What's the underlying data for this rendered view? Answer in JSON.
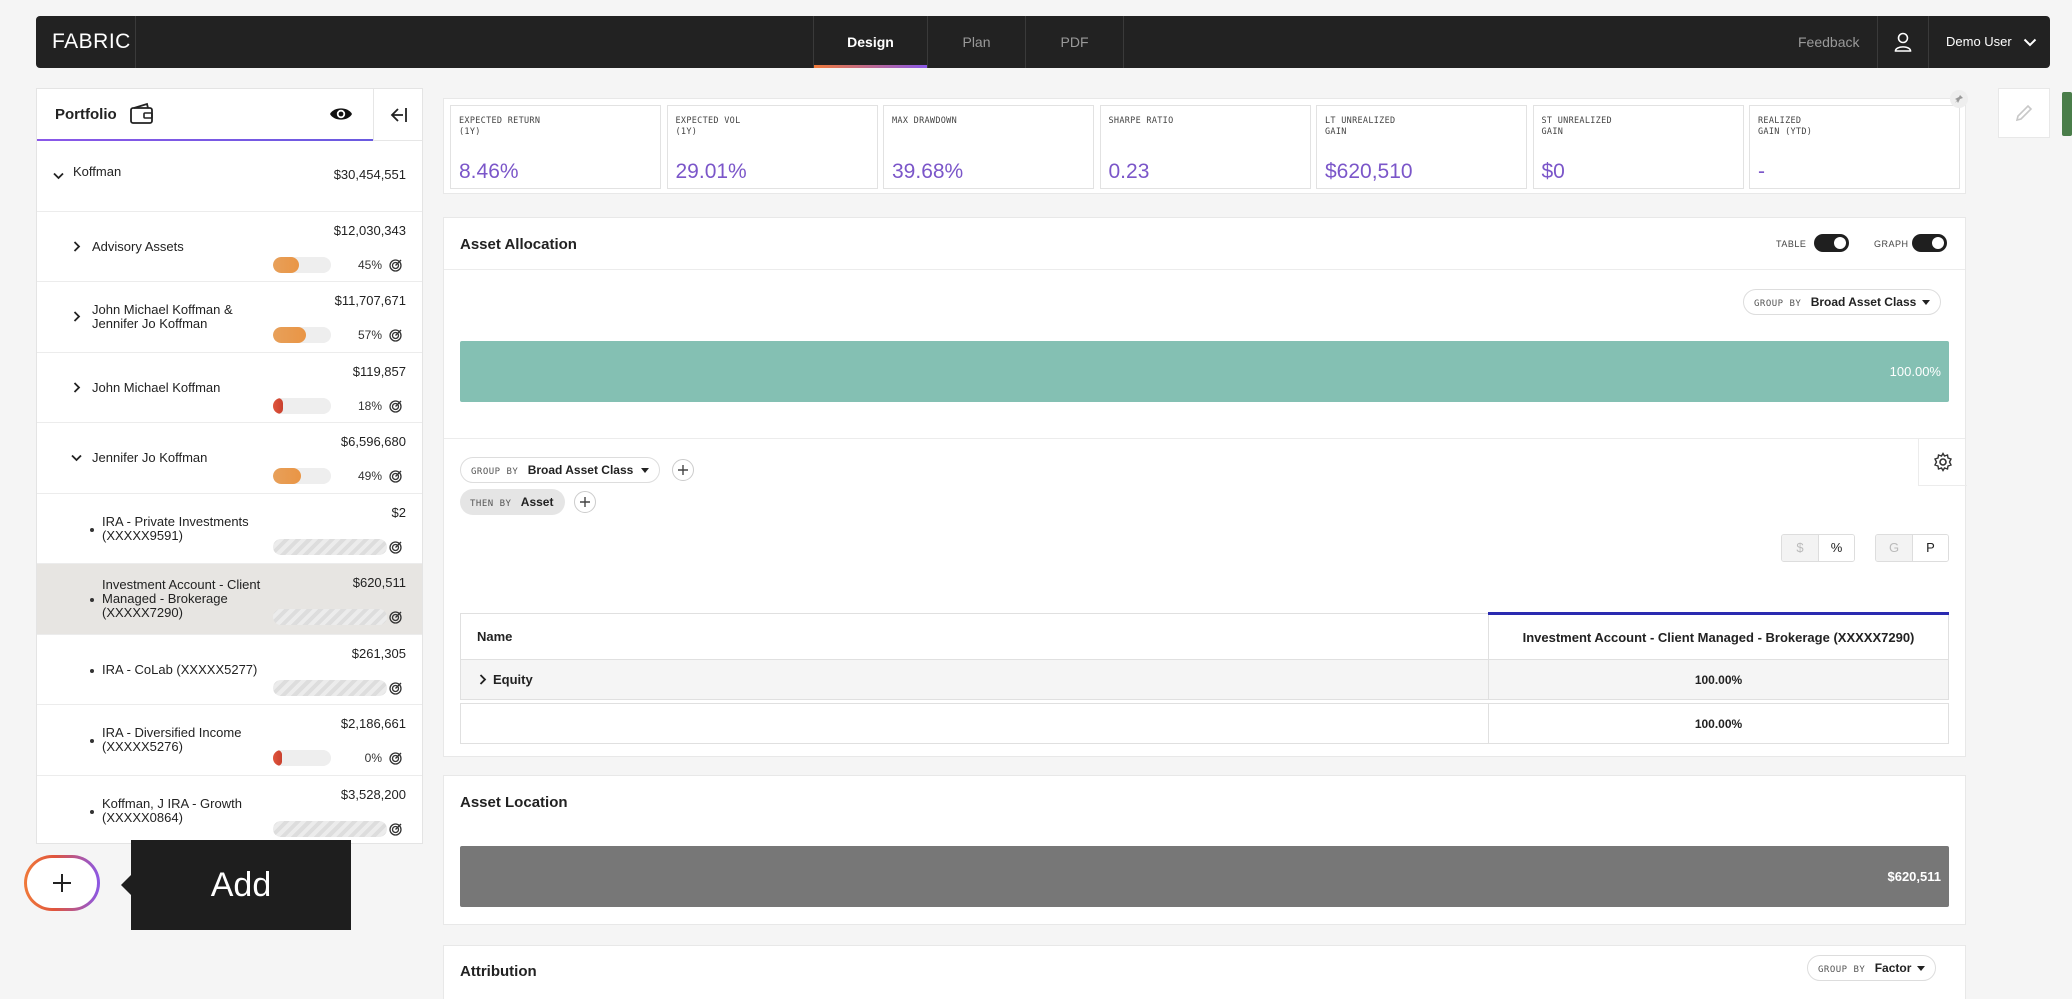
{
  "nav": {
    "logo": "FABRIC",
    "tabs": [
      {
        "label": "Design",
        "active": true
      },
      {
        "label": "Plan",
        "active": false
      },
      {
        "label": "PDF",
        "active": false
      }
    ],
    "feedback": "Feedback",
    "user_name": "Demo User",
    "icons": {
      "user": "user-icon",
      "chevron": "chevron-down-icon"
    }
  },
  "portfolio": {
    "title": "Portfolio",
    "icons": {
      "wallet": "wallet-icon",
      "eye": "eye-icon",
      "collapse": "collapse-left-icon"
    },
    "rows": [
      {
        "name": "Koffman",
        "amount": "$30,454,551"
      },
      {
        "name": "Advisory Assets",
        "amount": "$12,030,343",
        "pct": "45%",
        "fill": 0.45
      },
      {
        "name": "John Michael Koffman & Jennifer Jo Koffman",
        "amount": "$11,707,671",
        "pct": "57%",
        "fill": 0.57
      },
      {
        "name": "John Michael Koffman",
        "amount": "$119,857",
        "pct": "18%",
        "fill": 0.18
      },
      {
        "name": "Jennifer Jo Koffman",
        "amount": "$6,596,680",
        "pct": "49%",
        "fill": 0.49
      },
      {
        "name": "IRA - Private Investments (XXXXX9591)",
        "amount": "$2"
      },
      {
        "name": "Investment Account - Client Managed - Brokerage (XXXXX7290)",
        "amount": "$620,511"
      },
      {
        "name": "IRA - CoLab (XXXXX5277)",
        "amount": "$261,305"
      },
      {
        "name": "IRA - Diversified Income (XXXXX5276)",
        "amount": "$2,186,661",
        "pct": "0%",
        "fill": 0.0
      },
      {
        "name": "Koffman, J IRA - Growth (XXXXX0864)",
        "amount": "$3,528,200"
      }
    ]
  },
  "add_tooltip": "Add",
  "metrics": [
    {
      "label1": "EXPECTED RETURN",
      "label2": "(1Y)",
      "value": "8.46%"
    },
    {
      "label1": "EXPECTED VOL",
      "label2": "(1Y)",
      "value": "29.01%"
    },
    {
      "label1": "MAX DRAWDOWN",
      "label2": "",
      "value": "39.68%"
    },
    {
      "label1": "SHARPE RATIO",
      "label2": "",
      "value": "0.23"
    },
    {
      "label1": "LT UNREALIZED",
      "label2": "GAIN",
      "value": "$620,510"
    },
    {
      "label1": "ST UNREALIZED",
      "label2": "GAIN",
      "value": "$0"
    },
    {
      "label1": "REALIZED",
      "label2": "GAIN (YTD)",
      "value": "-"
    }
  ],
  "asset_allocation": {
    "title": "Asset Allocation",
    "table_label": "TABLE",
    "graph_label": "GRAPH",
    "group_by_label": "GROUP BY",
    "group_by_value": "Broad Asset Class",
    "bar_value": "100.00%",
    "then_by_label": "THEN BY",
    "then_by_value": "Asset",
    "seg1": [
      "$",
      "%"
    ],
    "seg2": [
      "G",
      "P"
    ],
    "table": {
      "col_name": "Name",
      "col_account": "Investment Account - Client Managed - Brokerage (XXXXX7290)",
      "rows": [
        {
          "name": "Equity",
          "value": "100.00%"
        },
        {
          "name": "",
          "value": "100.00%"
        }
      ]
    }
  },
  "asset_location": {
    "title": "Asset Location",
    "bar_value": "$620,511"
  },
  "attribution": {
    "title": "Attribution",
    "group_by_label": "GROUP BY",
    "group_by_value": "Factor"
  },
  "colors": {
    "accent_purple": "#7b56c9",
    "allocation_teal": "#84c0b3",
    "location_gray": "#777777",
    "progress_orange": "#e99545",
    "progress_red": "#c9402e",
    "table_accent": "#2a2ab0"
  }
}
